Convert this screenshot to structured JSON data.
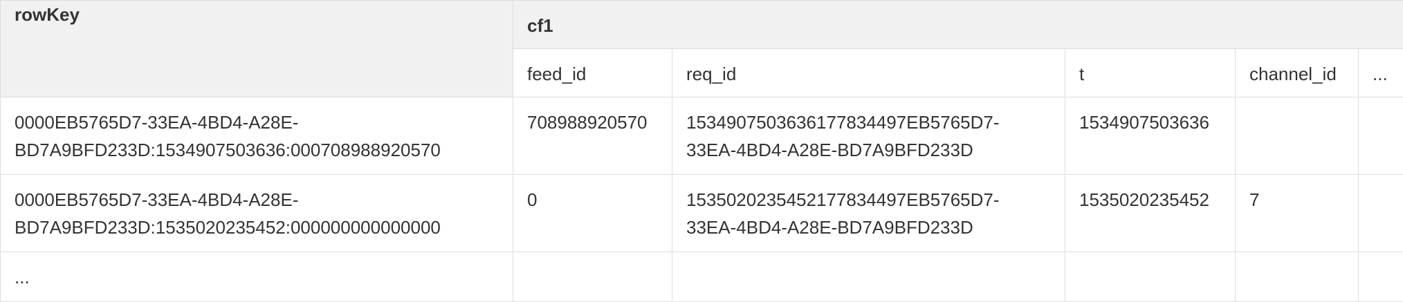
{
  "header": {
    "rowkey_label": "rowKey",
    "column_family_label": "cf1",
    "columns": [
      "feed_id",
      "req_id",
      "t",
      "channel_id",
      "..."
    ]
  },
  "rows": [
    {
      "rowkey_line1": "0000EB5765D7-33EA-4BD4-A28E-",
      "rowkey_line2": "BD7A9BFD233D:1534907503636:000708988920570",
      "feed_id": "708988920570",
      "req_id_line1": "1534907503636177834497EB5765D7-",
      "req_id_line2": "33EA-4BD4-A28E-BD7A9BFD233D",
      "t": "1534907503636",
      "channel_id": "",
      "more": ""
    },
    {
      "rowkey_line1": "0000EB5765D7-33EA-4BD4-A28E-",
      "rowkey_line2": "BD7A9BFD233D:1535020235452:000000000000000",
      "feed_id": "0",
      "req_id_line1": "1535020235452177834497EB5765D7-",
      "req_id_line2": "33EA-4BD4-A28E-BD7A9BFD233D",
      "t": "1535020235452",
      "channel_id": "7",
      "more": ""
    }
  ],
  "ellipsis_row": {
    "rowkey": "..."
  }
}
